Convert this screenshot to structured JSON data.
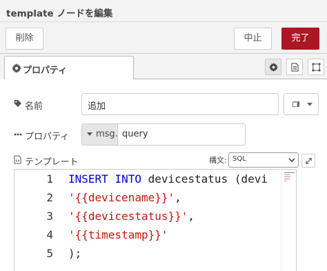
{
  "window": {
    "title": "template ノードを編集"
  },
  "toolbar": {
    "delete_label": "削除",
    "cancel_label": "中止",
    "done_label": "完了"
  },
  "tabs": [
    {
      "label": "プロパティ",
      "icon": "gear-icon"
    }
  ],
  "tab_tools": [
    "gear-icon",
    "document-icon",
    "frame-icon"
  ],
  "form": {
    "name_label": "名前",
    "name_value": "追加",
    "name_icon_button": "book-icon",
    "property_label": "プロパティ",
    "property_type": "msg.",
    "property_value": "query",
    "template_label": "テンプレート",
    "syntax_label": "構文:",
    "syntax_value": "SQL"
  },
  "editor": {
    "line_numbers": [
      "1",
      "2",
      "3",
      "4",
      "5"
    ],
    "lines": [
      {
        "keyword1": "INSERT",
        "keyword2": "INTO",
        "rest": " devicestatus (devi"
      },
      {
        "string": "'{{devicename}}'",
        "rest": ","
      },
      {
        "string": "'{{devicestatus}}'",
        "rest": ","
      },
      {
        "string": "'{{timestamp}}'"
      },
      {
        "rest": ");"
      }
    ]
  },
  "colors": {
    "done_button": "#ad1625",
    "keyword": "#0000cc",
    "string": "#c4160f"
  }
}
